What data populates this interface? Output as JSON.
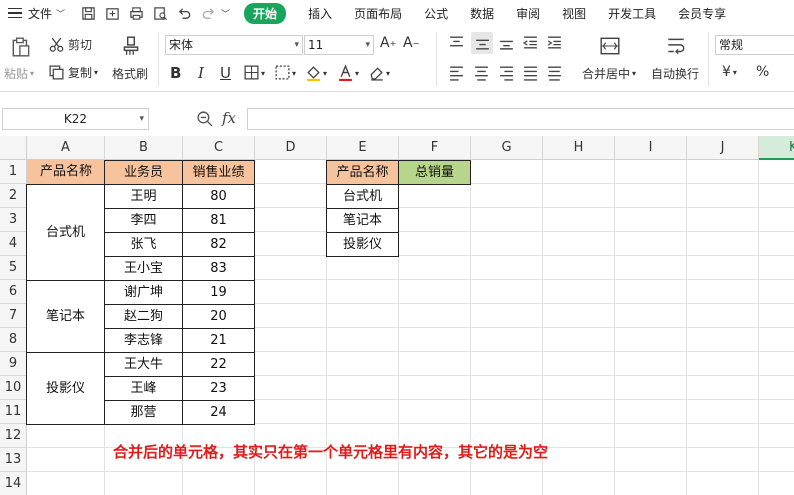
{
  "menubar": {
    "file_label": "文件",
    "tabs": [
      "开始",
      "插入",
      "页面布局",
      "公式",
      "数据",
      "审阅",
      "视图",
      "开发工具",
      "会员专享"
    ],
    "active_tab": "开始"
  },
  "ribbon": {
    "paste": "粘贴",
    "cut": "剪切",
    "copy": "复制",
    "format_painter": "格式刷",
    "font_name": "宋体",
    "font_size": "11",
    "merge_center": "合并居中",
    "wrap_text": "自动换行",
    "number_format": "常规",
    "currency_symbol": "¥",
    "percent_symbol": "%"
  },
  "formula_bar": {
    "cell_ref": "K22",
    "fx": "fx",
    "formula": ""
  },
  "grid": {
    "columns": [
      "A",
      "B",
      "C",
      "D",
      "E",
      "F",
      "G",
      "H",
      "I",
      "J",
      "K"
    ],
    "selected_column": "K",
    "rows": [
      "1",
      "2",
      "3",
      "4",
      "5",
      "6",
      "7",
      "8",
      "9",
      "10",
      "11",
      "12",
      "13",
      "14"
    ]
  },
  "table1": {
    "headers": [
      "产品名称",
      "业务员",
      "销售业绩"
    ],
    "groups": [
      "台式机",
      "笔记本",
      "投影仪"
    ],
    "salespeople": [
      "王明",
      "李四",
      "张飞",
      "王小宝",
      "谢广坤",
      "赵二狗",
      "李志锋",
      "王大牛",
      "王峰",
      "那营"
    ],
    "sales": [
      "80",
      "81",
      "82",
      "83",
      "19",
      "20",
      "21",
      "22",
      "23",
      "24"
    ]
  },
  "table2": {
    "headers": [
      "产品名称",
      "总销量"
    ],
    "products": [
      "台式机",
      "笔记本",
      "投影仪"
    ]
  },
  "note": "合并后的单元格，其实只在第一个单元格里有内容，其它的是为空",
  "colors": {
    "accent_green": "#19a55b",
    "header_orange": "#f6c39c",
    "header_green": "#b7d58b",
    "note_red": "#e01b1b"
  }
}
